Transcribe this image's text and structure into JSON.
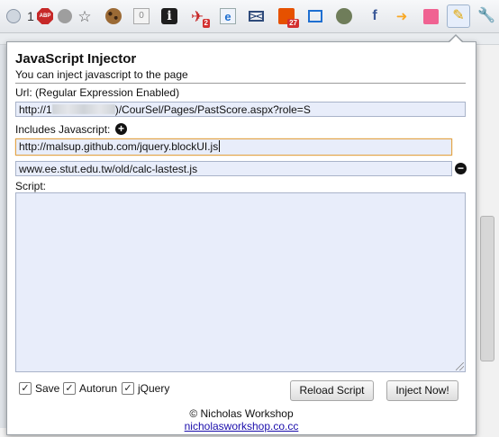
{
  "toolbar": {
    "counter": "1",
    "abp_label": "ABP",
    "zero_badge": "0",
    "info_glyph": "i",
    "mail_badge": "2",
    "calendar_badge": "27",
    "facebook_glyph": "f"
  },
  "popup": {
    "title": "JavaScript Injector",
    "subtitle": "You can inject javascript to the page",
    "url_label": "Url: (Regular Expression Enabled)",
    "url_prefix": "http://1",
    "url_suffix": ")/CourSel/Pages/PastScore.aspx?role=S",
    "includes_label": "Includes Javascript:",
    "include_1": "http://malsup.github.com/jquery.blockUI.js",
    "include_2": "www.ee.stut.edu.tw/old/calc-lastest.js",
    "script_label": "Script:",
    "save_label": "Save",
    "autorun_label": "Autorun",
    "jquery_label": "jQuery",
    "reload_button": "Reload Script",
    "inject_button": "Inject Now!",
    "copyright": "© Nicholas Workshop",
    "footer_link": "nicholasworkshop.co.cc"
  }
}
